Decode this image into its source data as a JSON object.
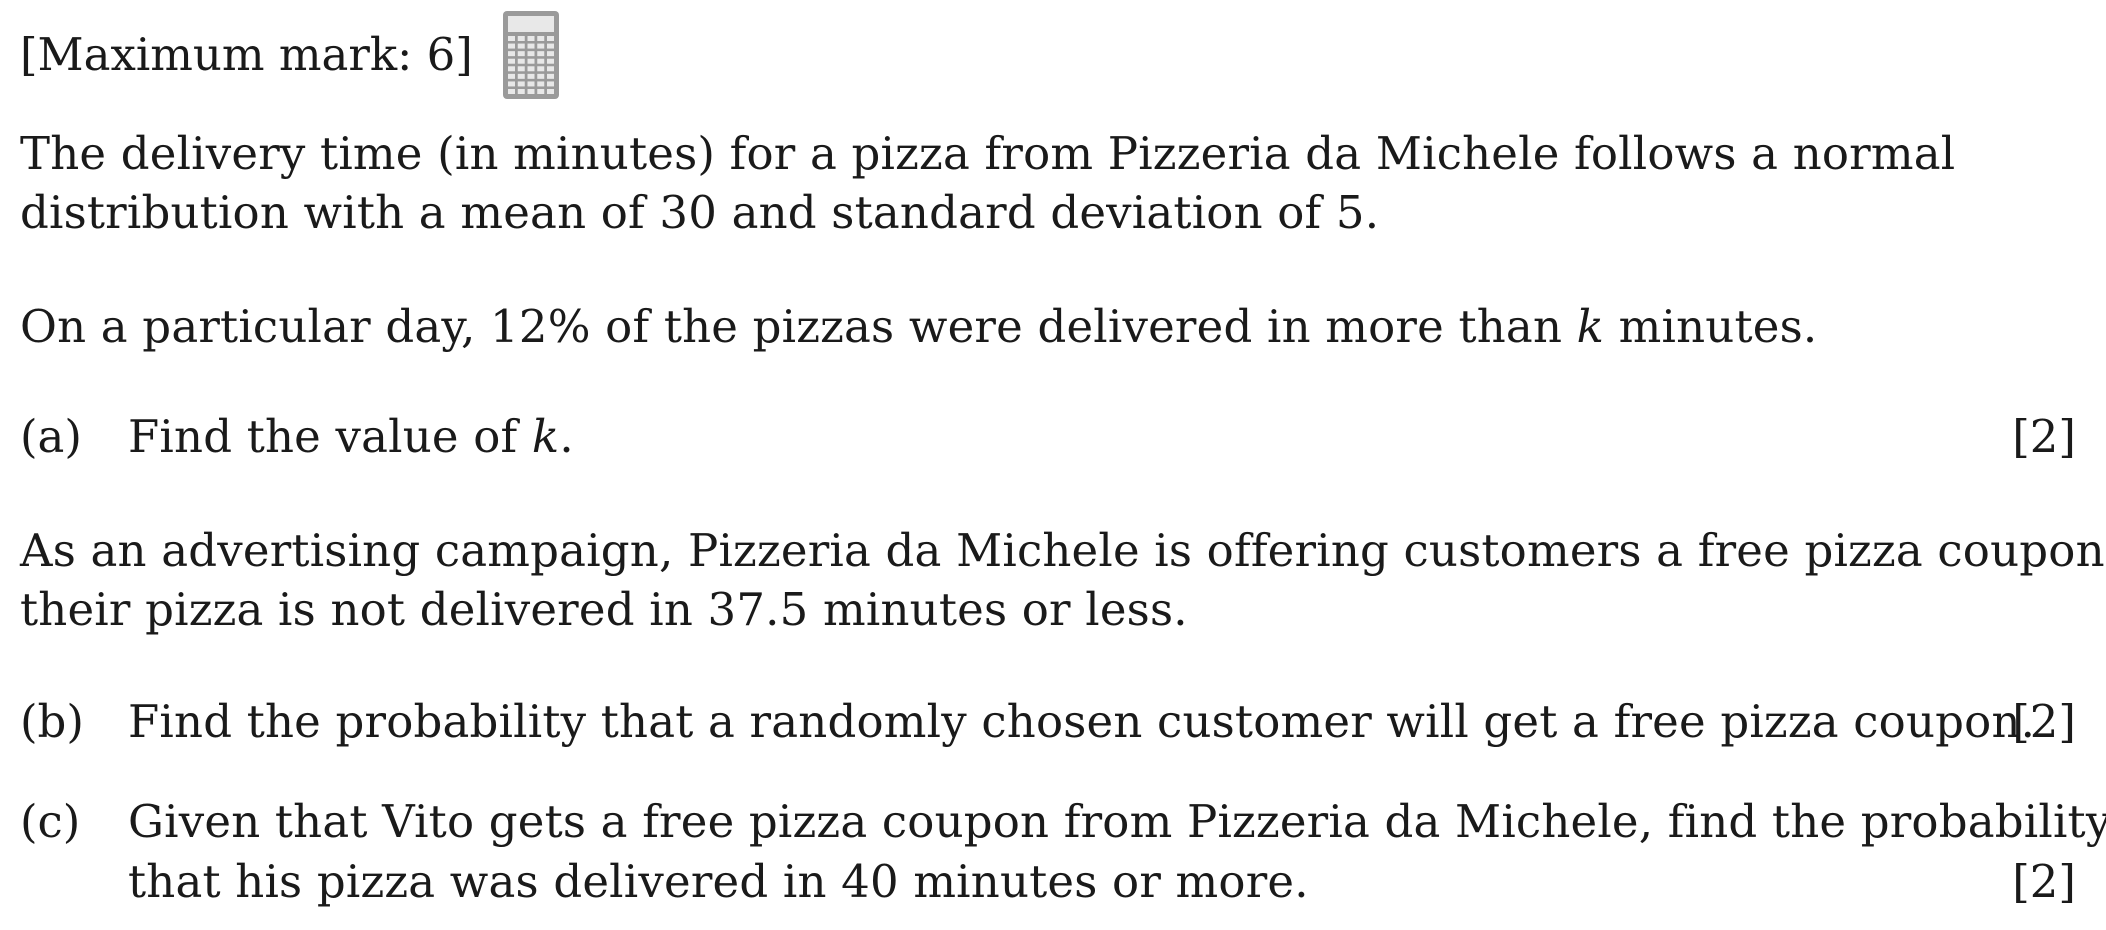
{
  "header": {
    "max_mark": "[Maximum mark: 6]",
    "calculator_icon": "calculator-icon"
  },
  "intro": {
    "line1": "The delivery time (in minutes) for a pizza from Pizzeria da Michele follows a normal",
    "line2": "distribution with a mean of 30 and standard deviation of 5."
  },
  "context1": {
    "before_var": "On a particular day, 12% of the pizzas were delivered in more than ",
    "var": "k",
    "after_var": " minutes."
  },
  "part_a": {
    "label": "(a)",
    "before_var": "Find the value of ",
    "var": "k",
    "after_var": ".",
    "marks": "[2]"
  },
  "context2": {
    "line1": "As an advertising campaign, Pizzeria da Michele is offering customers a free pizza coupon if",
    "line2": "their pizza is not delivered in 37.5 minutes or less."
  },
  "part_b": {
    "label": "(b)",
    "text": "Find the probability that a randomly chosen customer will get a free pizza coupon.",
    "marks": "[2]"
  },
  "part_c": {
    "label": "(c)",
    "line1": "Given that Vito gets a free pizza coupon from Pizzeria da Michele, find the probability",
    "line2": "that his pizza was delivered in 40 minutes or more.",
    "marks": "[2]"
  }
}
